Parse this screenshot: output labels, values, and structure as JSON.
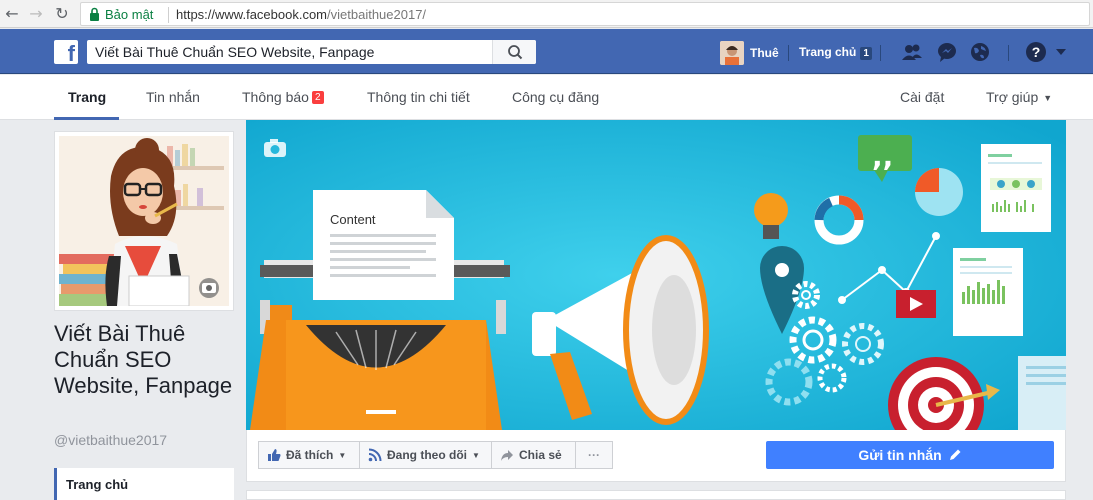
{
  "browser": {
    "secure_label": "Bảo mật",
    "url_host": "https://www.facebook.com",
    "url_path": "/vietbaithue2017/"
  },
  "topbar": {
    "logo": "f",
    "search_value": "Viết Bài Thuê Chuẩn SEO Website, Fanpage",
    "user_name": "Thuê",
    "home_label": "Trang chủ",
    "home_count": "1",
    "help_label": "?"
  },
  "tabs": {
    "home": "Trang",
    "messages": "Tin nhắn",
    "notifications": "Thông báo",
    "notifications_count": "2",
    "insights": "Thông tin chi tiết",
    "publishing_tools": "Công cụ đăng",
    "settings": "Cài đặt",
    "help": "Trợ giúp"
  },
  "page": {
    "name": "Viết Bài Thuê Chuẩn SEO Website, Fanpage",
    "handle": "@vietbaithue2017",
    "left_nav_active": "Trang chủ"
  },
  "cover": {
    "doc_label": "Content"
  },
  "actions": {
    "liked": "Đã thích",
    "following": "Đang theo dõi",
    "share": "Chia sẻ",
    "more": "···",
    "send_message": "Gửi tin nhắn"
  },
  "colors": {
    "facebook_blue": "#4267b2",
    "message_blue": "#4080ff",
    "cover_cyan": "#1cb6dc",
    "badge_red": "#fa3e3e"
  }
}
